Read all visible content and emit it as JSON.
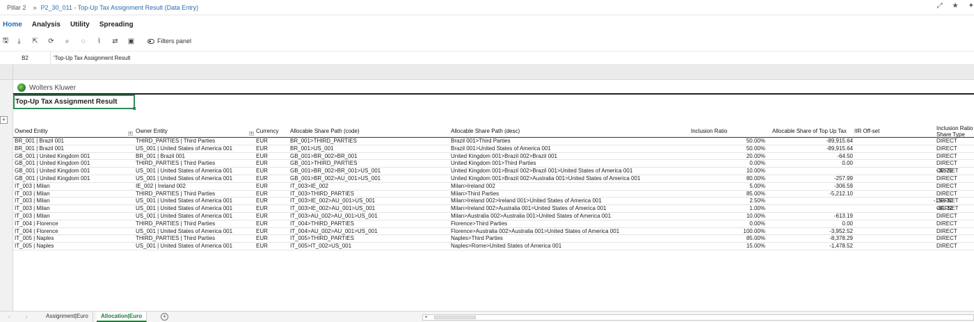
{
  "breadcrumb": {
    "root": "Pillar 2",
    "separator": "»",
    "current": "P2_30_011 - Top-Up Tax Assignment Result (Data Entry)"
  },
  "window_icons": [
    "collapse-icon",
    "star-icon",
    "pin-icon"
  ],
  "menu": {
    "tabs": [
      {
        "label": "Home",
        "active": true
      },
      {
        "label": "Analysis",
        "active": false
      },
      {
        "label": "Utility",
        "active": false
      },
      {
        "label": "Spreading",
        "active": false
      }
    ]
  },
  "toolbar": {
    "icons": [
      "save-icon",
      "download-icon",
      "export-icon",
      "refresh-icon",
      "comment-thread-icon",
      "comment-icon",
      "attach-icon",
      "sync-icon",
      "camera-icon"
    ],
    "filters_label": "Filters panel"
  },
  "formula_bar": {
    "cell_ref": "B2",
    "formula": "'Top-Up Tax Assignment Result"
  },
  "sheet": {
    "logo_text": "Wolters Kluwer",
    "title": "Top-Up Tax Assignment Result",
    "expander": "+",
    "columns": [
      "Owned Entity",
      "Owner Entity",
      "Currency",
      "Allocable Share Path (code)",
      "Allocable Share Path (desc)",
      "Inclusion Ratio",
      "Allocable Share of Top Up Tax",
      "IIR Off-set",
      "Inclusion Ratio Share Type"
    ],
    "rows": [
      [
        "BR_001 | Brazil 001",
        "THIRD_PARTIES | Third Parties",
        "EUR",
        "BR_001>THIRD_PARTIES",
        "Brazil 001>Third Parties",
        "50.00%",
        "-89,915.64",
        "",
        "DIRECT"
      ],
      [
        "BR_001 | Brazil 001",
        "US_001 | United States of America 001",
        "EUR",
        "BR_001>US_001",
        "Brazil 001>United States of America 001",
        "50.00%",
        "-89,915.64",
        "",
        "DIRECT"
      ],
      [
        "GB_001 | United Kingdom 001",
        "BR_001 | Brazil 001",
        "EUR",
        "GB_001>BR_002>BR_001",
        "United Kingdom 001>Brazil 002>Brazil 001",
        "20.00%",
        "-64.50",
        "",
        "DIRECT"
      ],
      [
        "GB_001 | United Kingdom 001",
        "THIRD_PARTIES | Third Parties",
        "EUR",
        "GB_001>THIRD_PARTIES",
        "United Kingdom 001>Third Parties",
        "0.00%",
        "0.00",
        "",
        "DIRECT"
      ],
      [
        "GB_001 | United Kingdom 001",
        "US_001 | United States of America 001",
        "EUR",
        "GB_001>BR_002>BR_001>US_001",
        "United Kingdom 001>Brazil 002>Brazil 001>United States of America 001",
        "10.00%",
        "",
        "-32.25",
        "OFFSET"
      ],
      [
        "GB_001 | United Kingdom 001",
        "US_001 | United States of America 001",
        "EUR",
        "GB_001>BR_002>AU_001>US_001",
        "United Kingdom 001>Brazil 002>Australia 001>United States of America 001",
        "80.00%",
        "-257.99",
        "",
        "DIRECT"
      ],
      [
        "IT_003 | Milan",
        "IE_002 | Ireland 002",
        "EUR",
        "IT_003>IE_002",
        "Milan>Ireland 002",
        "5.00%",
        "-306.59",
        "",
        "DIRECT"
      ],
      [
        "IT_003 | Milan",
        "THIRD_PARTIES | Third Parties",
        "EUR",
        "IT_003>THIRD_PARTIES",
        "Milan>Third Parties",
        "85.00%",
        "-5,212.10",
        "",
        "DIRECT"
      ],
      [
        "IT_003 | Milan",
        "US_001 | United States of America 001",
        "EUR",
        "IT_003>IE_002>AU_001>US_001",
        "Milan>Ireland 002>Ireland 001>United States of America 001",
        "2.50%",
        "",
        "-153.30",
        "OFFSET"
      ],
      [
        "IT_003 | Milan",
        "US_001 | United States of America 001",
        "EUR",
        "IT_003>IE_002>AU_001>US_001",
        "Milan>Ireland 002>Australia 001>United States of America 001",
        "1.00%",
        "",
        "-61.32",
        "OFFSET"
      ],
      [
        "IT_003 | Milan",
        "US_001 | United States of America 001",
        "EUR",
        "IT_003>AU_002>AU_001>US_001",
        "Milan>Australia 002>Australia 001>United States of America 001",
        "10.00%",
        "-613.19",
        "",
        "DIRECT"
      ],
      [
        "IT_004 | Florence",
        "THIRD_PARTIES | Third Parties",
        "EUR",
        "IT_004>THIRD_PARTIES",
        "Florence>Third Parties",
        "0.00%",
        "0.00",
        "",
        "DIRECT"
      ],
      [
        "IT_004 | Florence",
        "US_001 | United States of America 001",
        "EUR",
        "IT_004>AU_002>AU_001>US_001",
        "Florence>Australia 002>Australia 001>United States of America 001",
        "100.00%",
        "-3,952.52",
        "",
        "DIRECT"
      ],
      [
        "IT_005 | Naples",
        "THIRD_PARTIES | Third Parties",
        "EUR",
        "IT_005>THIRD_PARTIES",
        "Naples>Third Parties",
        "85.00%",
        "-8,378.29",
        "",
        "DIRECT"
      ],
      [
        "IT_005 | Naples",
        "US_001 | United States of America 001",
        "EUR",
        "IT_005>IT_002>US_001",
        "Naples>Rome>United States of America 001",
        "15.00%",
        "-1,478.52",
        "",
        "DIRECT"
      ]
    ]
  },
  "sheet_tabs": [
    {
      "label": "Assignment|Euro",
      "active": false
    },
    {
      "label": "Allocation|Euro",
      "active": true
    }
  ],
  "nav_arrows": "‹ ›",
  "add_sheet": "+",
  "colors": {
    "accent": "#1f6fc0",
    "active_tab": "#1f7a3a",
    "selection": "#2e8b57"
  }
}
